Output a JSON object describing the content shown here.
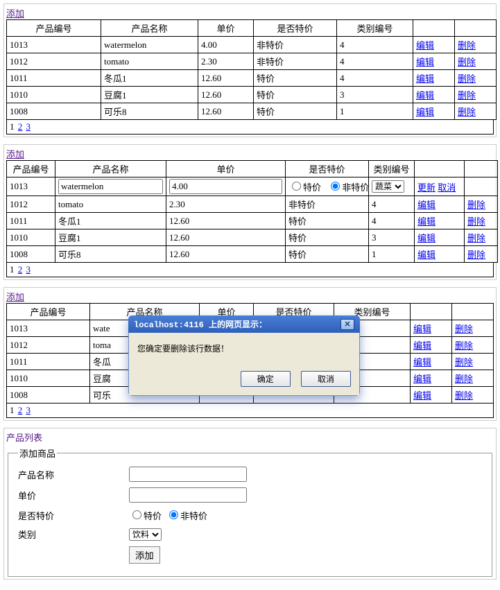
{
  "labels": {
    "add": "添加",
    "product_id": "产品编号",
    "product_name": "产品名称",
    "unit_price": "单价",
    "is_special": "是否特价",
    "category_id": "类别编号",
    "edit": "编辑",
    "delete": "删除",
    "update": "更新",
    "cancel": "取消",
    "pages": [
      "1",
      "2",
      "3"
    ],
    "special": "特价",
    "not_special": "非特价",
    "product_list": "产品列表",
    "add_product": "添加商品",
    "product_name_f": "产品名称",
    "unit_price_f": "单价",
    "is_special_f": "是否特价",
    "category_f": "类别",
    "submit": "添加"
  },
  "table1": {
    "rows": [
      {
        "id": "1013",
        "name": "watermelon",
        "price": "4.00",
        "special": "非特价",
        "cat": "4"
      },
      {
        "id": "1012",
        "name": "tomato",
        "price": "2.30",
        "special": "非特价",
        "cat": "4"
      },
      {
        "id": "1011",
        "name": "冬瓜1",
        "price": "12.60",
        "special": "特价",
        "cat": "4"
      },
      {
        "id": "1010",
        "name": "豆腐1",
        "price": "12.60",
        "special": "特价",
        "cat": "3"
      },
      {
        "id": "1008",
        "name": "可乐8",
        "price": "12.60",
        "special": "特价",
        "cat": "1"
      }
    ]
  },
  "table2": {
    "edit_row": {
      "id": "1013",
      "name": "watermelon",
      "price": "4.00",
      "cat_option": "蔬菜"
    },
    "rows": [
      {
        "id": "1012",
        "name": "tomato",
        "price": "2.30",
        "special": "非特价",
        "cat": "4"
      },
      {
        "id": "1011",
        "name": "冬瓜1",
        "price": "12.60",
        "special": "特价",
        "cat": "4"
      },
      {
        "id": "1010",
        "name": "豆腐1",
        "price": "12.60",
        "special": "特价",
        "cat": "3"
      },
      {
        "id": "1008",
        "name": "可乐8",
        "price": "12.60",
        "special": "特价",
        "cat": "1"
      }
    ]
  },
  "table3": {
    "rows": [
      {
        "id": "1013",
        "name": "wate",
        "price": "",
        "special": "",
        "cat": ""
      },
      {
        "id": "1012",
        "name": "toma",
        "price": "",
        "special": "",
        "cat": ""
      },
      {
        "id": "1011",
        "name": "冬瓜",
        "price": "",
        "special": "",
        "cat": ""
      },
      {
        "id": "1010",
        "name": "豆腐",
        "price": "",
        "special": "",
        "cat": ""
      },
      {
        "id": "1008",
        "name": "可乐",
        "price": "",
        "special": "",
        "cat": ""
      }
    ]
  },
  "dialog": {
    "title": "localhost:4116 上的网页显示：",
    "message": "您确定要删除该行数据！",
    "ok": "确定",
    "cancel": "取消"
  },
  "form_select_option": "饮料"
}
